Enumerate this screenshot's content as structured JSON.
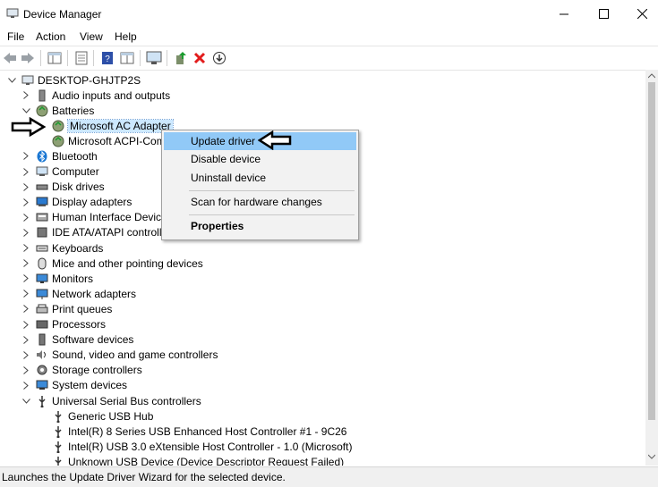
{
  "window": {
    "title": "Device Manager"
  },
  "menu": [
    "File",
    "Action",
    "View",
    "Help"
  ],
  "tree": {
    "root": "DESKTOP-GHJTP2S",
    "items": [
      {
        "label": "Audio inputs and outputs",
        "icon": "speaker-icon"
      },
      {
        "label": "Batteries",
        "icon": "battery-icon"
      },
      {
        "label": "Microsoft AC Adapter",
        "icon": "battery-icon"
      },
      {
        "label": "Microsoft ACPI-Com",
        "icon": "battery-icon"
      },
      {
        "label": "Bluetooth",
        "icon": "bluetooth-icon"
      },
      {
        "label": "Computer",
        "icon": "computer-icon"
      },
      {
        "label": "Disk drives",
        "icon": "disk-drive-icon"
      },
      {
        "label": "Display adapters",
        "icon": "display-adapter-icon"
      },
      {
        "label": "Human Interface Device",
        "icon": "hid-icon"
      },
      {
        "label": "IDE ATA/ATAPI controlle",
        "icon": "ide-icon"
      },
      {
        "label": "Keyboards",
        "icon": "keyboard-icon"
      },
      {
        "label": "Mice and other pointing devices",
        "icon": "mouse-icon"
      },
      {
        "label": "Monitors",
        "icon": "monitor-icon"
      },
      {
        "label": "Network adapters",
        "icon": "network-icon"
      },
      {
        "label": "Print queues",
        "icon": "printer-icon"
      },
      {
        "label": "Processors",
        "icon": "processor-icon"
      },
      {
        "label": "Software devices",
        "icon": "software-device-icon"
      },
      {
        "label": "Sound, video and game controllers",
        "icon": "sound-icon"
      },
      {
        "label": "Storage controllers",
        "icon": "storage-icon"
      },
      {
        "label": "System devices",
        "icon": "system-device-icon"
      },
      {
        "label": "Universal Serial Bus controllers",
        "icon": "usb-icon"
      },
      {
        "label": "Generic USB Hub",
        "icon": "usb-icon"
      },
      {
        "label": "Intel(R) 8 Series USB Enhanced Host Controller #1 - 9C26",
        "icon": "usb-icon"
      },
      {
        "label": "Intel(R) USB 3.0 eXtensible Host Controller - 1.0 (Microsoft)",
        "icon": "usb-icon"
      },
      {
        "label": "Unknown USB Device (Device Descriptor Request Failed)",
        "icon": "usb-icon"
      }
    ]
  },
  "context_menu": {
    "items": [
      "Update driver",
      "Disable device",
      "Uninstall device",
      "Scan for hardware changes",
      "Properties"
    ]
  },
  "status": "Launches the Update Driver Wizard for the selected device.",
  "colors": {
    "selection": "#cce8ff",
    "menu_highlight": "#91c9f7"
  }
}
